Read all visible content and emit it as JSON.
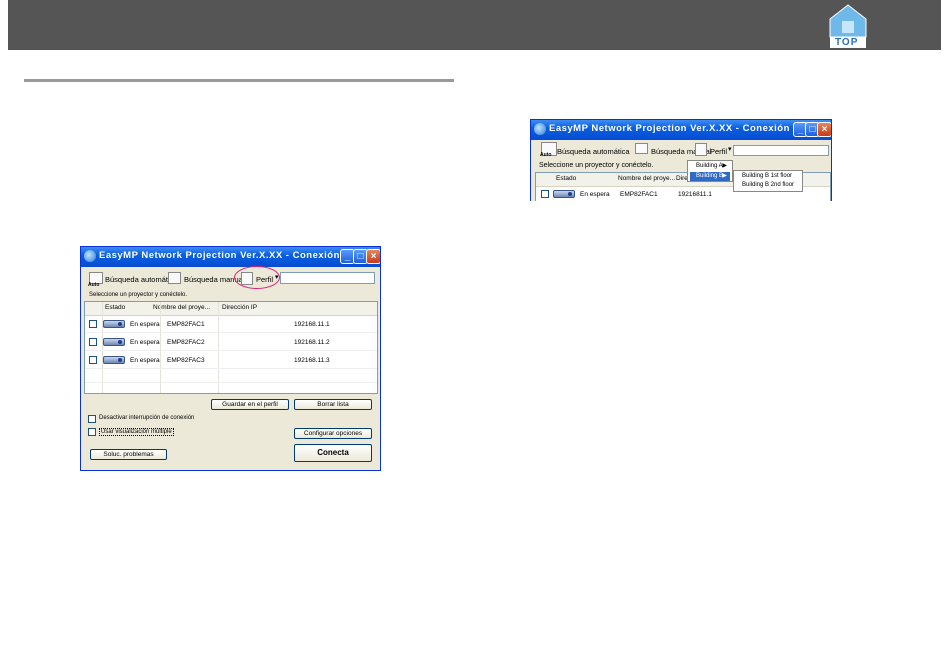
{
  "header": {
    "top_label": "TOP"
  },
  "windows": {
    "main": {
      "title": "EasyMP Network Projection  Ver.X.XX  -  Conexión avanzada  -",
      "toolbar": {
        "auto_search": "Búsqueda automática",
        "auto_icon_text": "Auto",
        "manual_search": "Búsqueda manual",
        "profile": "Perfil"
      },
      "select_label": "Seleccione un proyector y conéctelo.",
      "columns": [
        "Estado",
        "Nombre del proye...",
        "Dirección IP"
      ],
      "rows": [
        {
          "status": "En espera",
          "name": "EMP82FAC1",
          "ip": "192168.11.1"
        },
        {
          "status": "En espera",
          "name": "EMP82FAC2",
          "ip": "192168.11.2"
        },
        {
          "status": "En espera",
          "name": "EMP82FAC3",
          "ip": "192168.11.3"
        }
      ],
      "buttons": {
        "save_profile": "Guardar en el perfil",
        "clear_list": "Borrar lista",
        "configure": "Configurar opciones",
        "troubleshoot": "Soluc. problemas",
        "connect": "Conecta"
      },
      "options": {
        "disable_interrupt": "Desactivar interrupción de conexión",
        "multi_display": "Usar visualización múltiple"
      }
    },
    "small": {
      "title": "EasyMP Network Projection  Ver.X.XX  -  Conexión avanzada  -",
      "toolbar": {
        "auto_search": "Búsqueda automática",
        "auto_icon_text": "Auto",
        "manual_search": "Búsqueda manual",
        "profile": "Perfil"
      },
      "select_label": "Seleccione un proyector y conéctelo.",
      "columns": [
        "Estado",
        "Nombre del proye...",
        "Direc"
      ],
      "row": {
        "status": "En espera",
        "name": "EMP82FAC1",
        "ip": "19216811.1"
      },
      "menu": {
        "items": [
          "Building A",
          "Building B"
        ],
        "submenu": [
          "Building B 1st floor",
          "Building B 2nd floor"
        ]
      }
    }
  }
}
